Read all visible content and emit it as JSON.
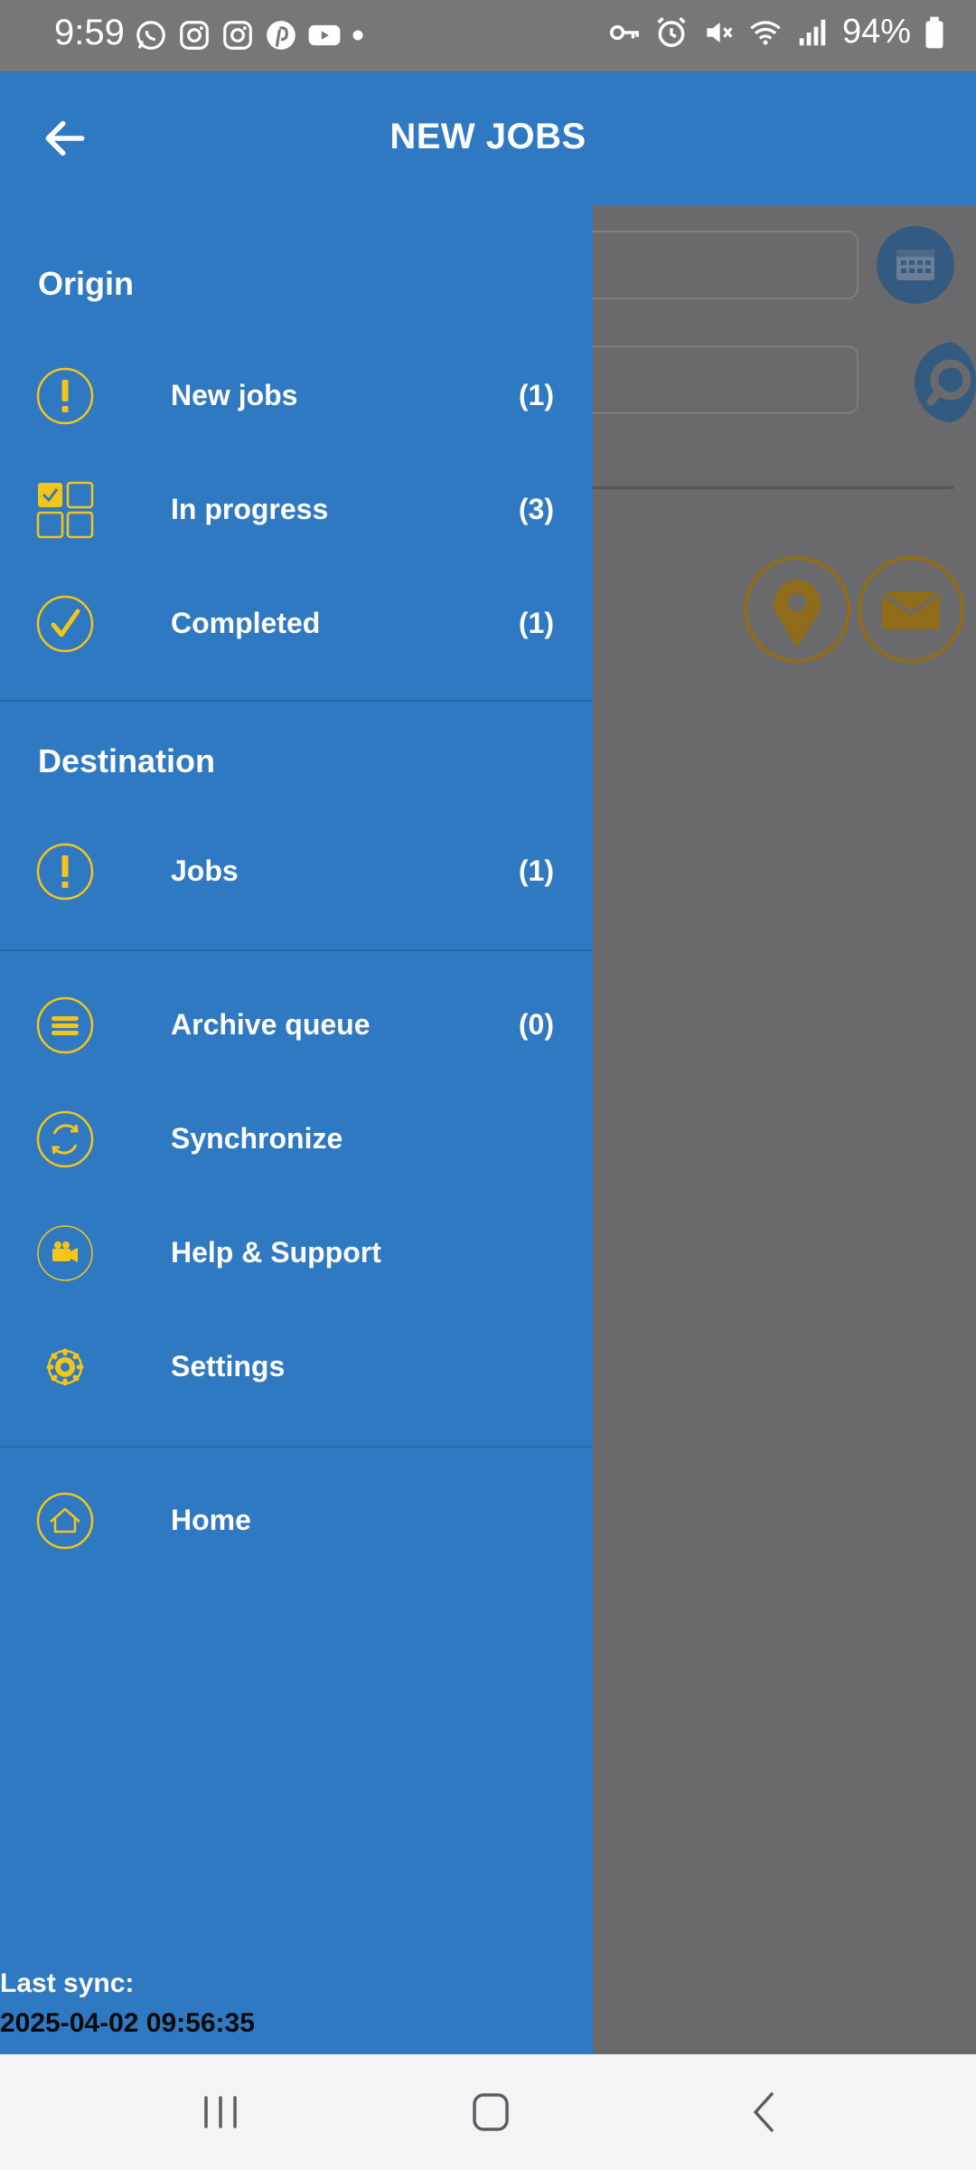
{
  "status_bar": {
    "time": "9:59",
    "battery": "94%",
    "left_icons": [
      "whatsapp-icon",
      "instagram-icon",
      "instagram-icon",
      "pinterest-icon",
      "youtube-icon",
      "dot-icon"
    ],
    "right_icons": [
      "key-icon",
      "alarm-icon",
      "mute-icon",
      "wifi-icon",
      "signal-icon",
      "battery-icon"
    ]
  },
  "header": {
    "title": "NEW JOBS",
    "back_icon": "arrow-left-icon"
  },
  "drawer": {
    "origin_title": "Origin",
    "origin_items": [
      {
        "label": "New jobs",
        "count": "(1)",
        "icon": "exclamation-circle-icon"
      },
      {
        "label": "In progress",
        "count": "(3)",
        "icon": "checklist-grid-icon"
      },
      {
        "label": "Completed",
        "count": "(1)",
        "icon": "check-circle-icon"
      }
    ],
    "destination_title": "Destination",
    "destination_items": [
      {
        "label": "Jobs",
        "count": "(1)",
        "icon": "exclamation-circle-icon"
      }
    ],
    "tool_items": [
      {
        "label": "Archive queue",
        "count": "(0)",
        "icon": "stack-icon"
      },
      {
        "label": "Synchronize",
        "icon": "sync-icon"
      },
      {
        "label": "Help & Support",
        "icon": "video-camera-icon"
      },
      {
        "label": "Settings",
        "icon": "gear-icon"
      }
    ],
    "home_item": {
      "label": "Home",
      "icon": "home-icon"
    },
    "last_sync_label": "Last sync:",
    "last_sync_value": "2025-04-02 09:56:35"
  },
  "colors": {
    "primary": "#2f78c2",
    "accent": "#f5c518",
    "overlay": "#6a696c"
  }
}
